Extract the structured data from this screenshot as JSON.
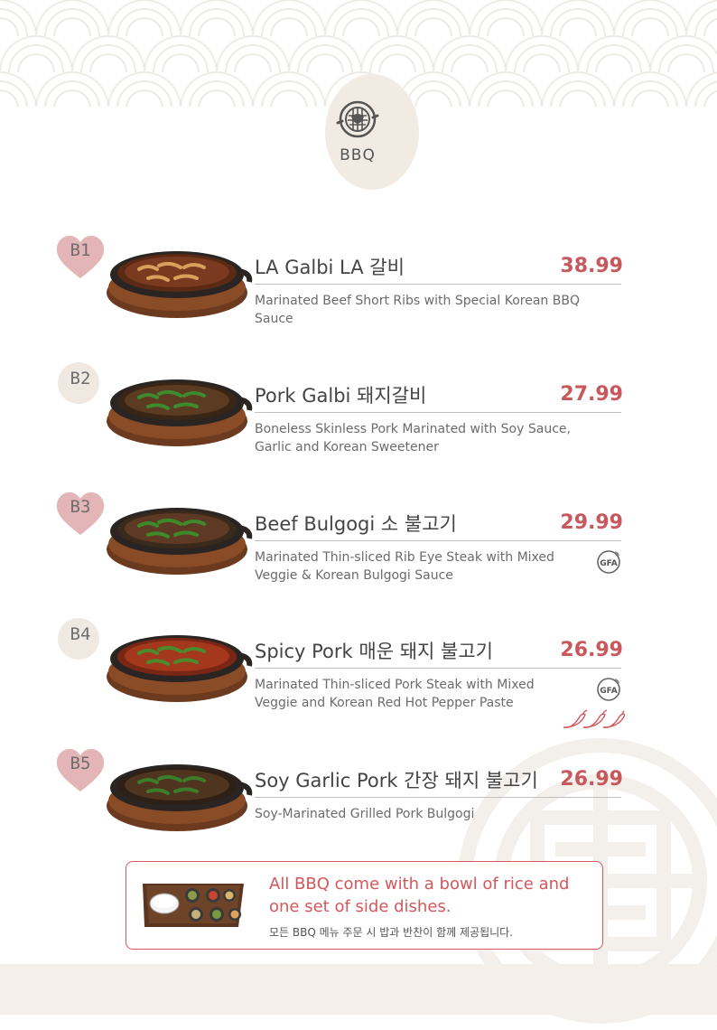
{
  "category": {
    "label": "BBQ",
    "icon": "grill-icon"
  },
  "colors": {
    "accent_red": "#c9585c",
    "heart_pink": "#e3b5b6",
    "circle_beige": "#f1ebe4"
  },
  "items": [
    {
      "code": "B1",
      "badge_shape": "heart",
      "name": "LA Galbi  LA 갈비",
      "price": "38.99",
      "desc": "Marinated Beef Short Ribs with Special Korean BBQ Sauce",
      "gfa": false,
      "spicy": false
    },
    {
      "code": "B2",
      "badge_shape": "circle",
      "name": "Pork Galbi 돼지갈비",
      "price": "27.99",
      "desc": "Boneless Skinless Pork Marinated with Soy Sauce, Garlic and Korean Sweetener",
      "gfa": false,
      "spicy": false
    },
    {
      "code": "B3",
      "badge_shape": "heart",
      "name": "Beef Bulgogi 소 불고기",
      "price": "29.99",
      "desc": "Marinated Thin-sliced Rib Eye Steak with Mixed Veggie & Korean Bulgogi Sauce",
      "gfa": true,
      "spicy": false
    },
    {
      "code": "B4",
      "badge_shape": "circle",
      "name": "Spicy Pork 매운 돼지 불고기",
      "price": "26.99",
      "desc": "Marinated Thin-sliced Pork Steak with Mixed Veggie and Korean Red Hot Pepper Paste",
      "gfa": true,
      "spicy": true
    },
    {
      "code": "B5",
      "badge_shape": "heart",
      "name": "Soy Garlic Pork 간장 돼지 불고기",
      "price": "26.99",
      "desc": "Soy-Marinated Grilled Pork Bulgogi",
      "gfa": false,
      "spicy": false
    }
  ],
  "gfa_label": "GFA",
  "notice": {
    "english": "All BBQ come with a bowl of rice and one set of side dishes.",
    "korean": "모든 BBQ 메뉴 주문 시 밥과 반찬이 함께 제공됩니다."
  }
}
